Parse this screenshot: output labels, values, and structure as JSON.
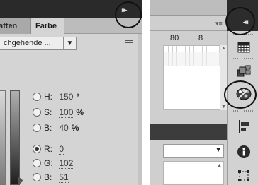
{
  "left_panel": {
    "collapse_glyph": "▸▸",
    "tabs": [
      {
        "label": "aften",
        "active": false
      },
      {
        "label": "Farbe",
        "active": true
      }
    ],
    "mode_dropdown": {
      "value": "chgehende ...",
      "arrow": "▼"
    },
    "fields": [
      {
        "label": "H:",
        "value": "150",
        "unit": "°",
        "checked": false
      },
      {
        "label": "S:",
        "value": "100",
        "unit": "%",
        "checked": false
      },
      {
        "label": "B:",
        "value": "40",
        "unit": "%",
        "checked": false
      },
      {
        "label": "R:",
        "value": "0",
        "unit": "",
        "checked": true
      },
      {
        "label": "G:",
        "value": "102",
        "unit": "",
        "checked": false
      },
      {
        "label": "B:",
        "value": "51",
        "unit": "",
        "checked": false
      }
    ]
  },
  "right_panel": {
    "collapse_glyph": "◂◂",
    "menu_glyph": "▾≡",
    "ruler": [
      "80",
      "8"
    ],
    "dropdown_arrow": "▼",
    "scroll_up": "▲",
    "scroll_down": "▼",
    "tools": [
      {
        "name": "swatches-grid-icon"
      },
      {
        "name": "color-cube-icon"
      },
      {
        "name": "palette-color-icon",
        "highlighted": true
      },
      {
        "name": "align-icon"
      },
      {
        "name": "info-icon"
      },
      {
        "name": "transform-icon"
      }
    ]
  },
  "colors": {
    "dark_bar": "#2a2a2a",
    "panel_bg": "#d4d4d4",
    "highlight_circle": "#111111"
  }
}
